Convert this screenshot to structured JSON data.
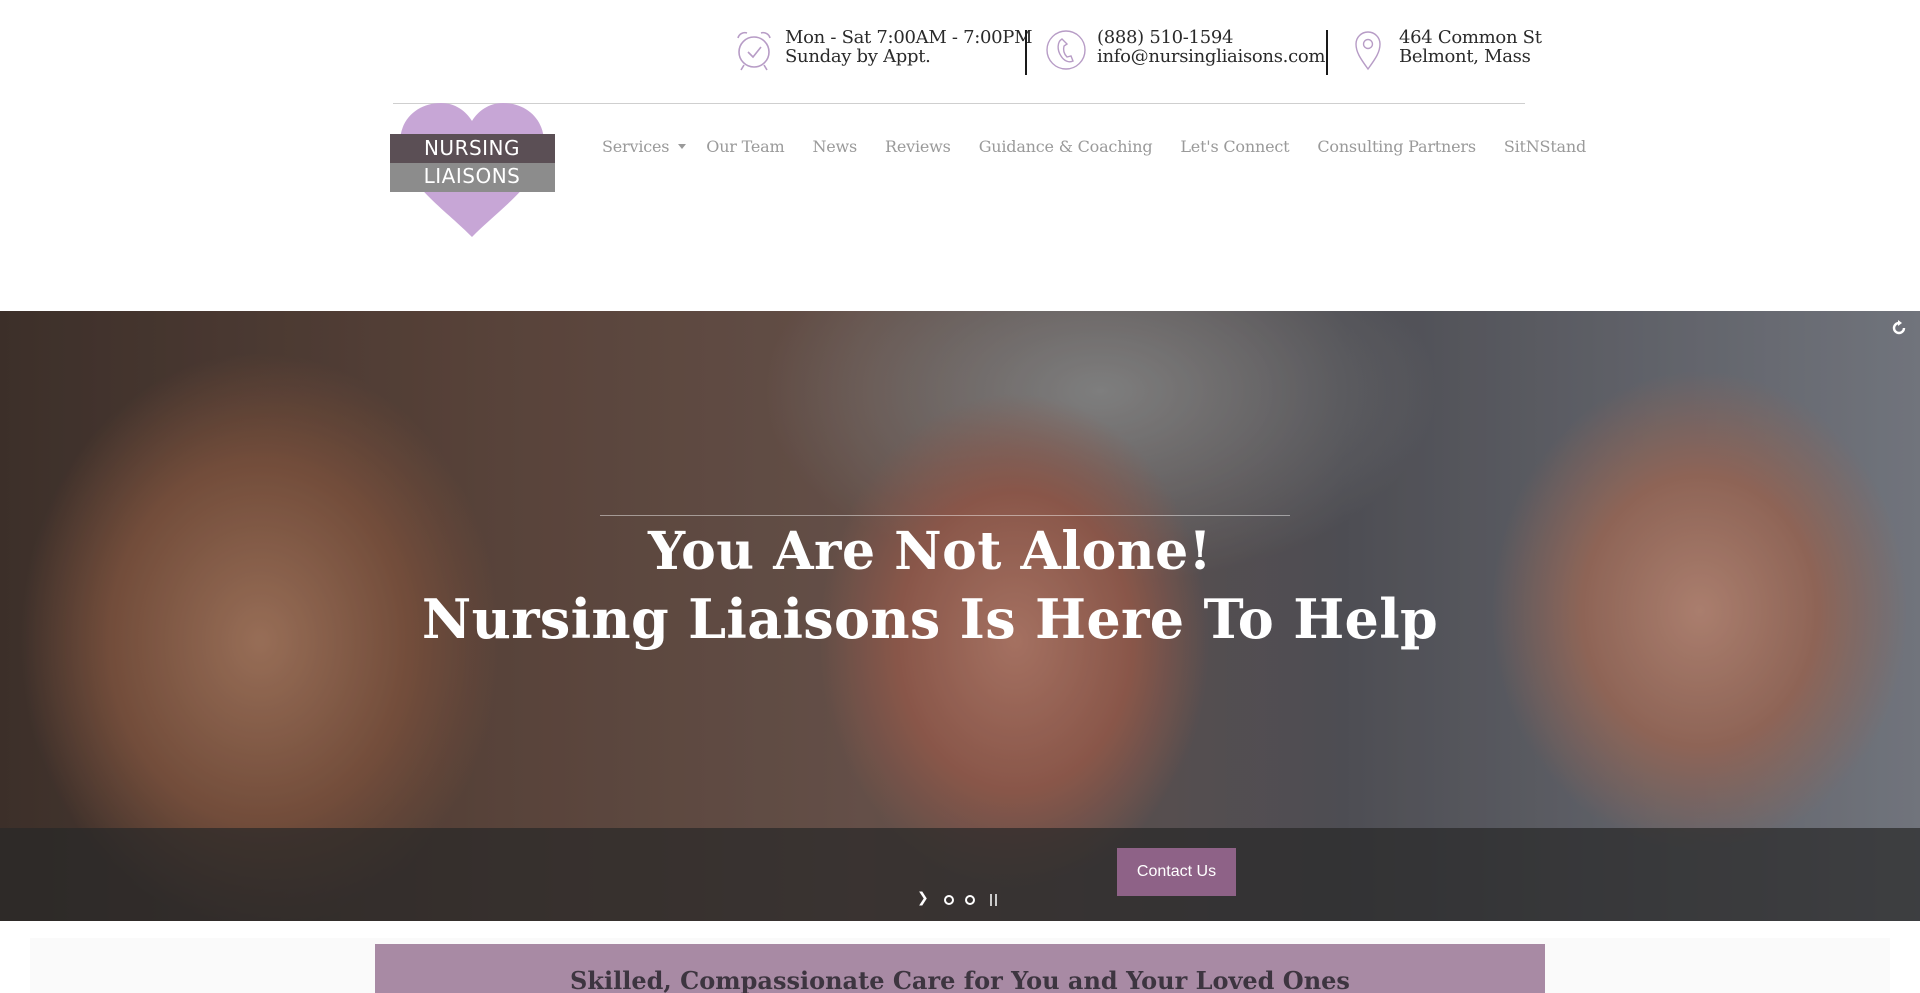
{
  "contact_bar": {
    "hours": {
      "icon": "alarm-clock-icon",
      "line1": "Mon - Sat 7:00AM - 7:00PM",
      "line2": "Sunday by Appt."
    },
    "phone": {
      "icon": "phone-icon",
      "line1": "(888) 510-1594",
      "line2": "info@nursingliaisons.com"
    },
    "address": {
      "icon": "map-pin-icon",
      "line1": "464 Common St",
      "line2": "Belmont, Mass"
    }
  },
  "logo": {
    "line1": "NURSING",
    "line2": "LIAISONS",
    "heart_color": "#c7a6d6"
  },
  "nav": {
    "items": [
      {
        "label": "Services",
        "has_dropdown": true
      },
      {
        "label": "Our Team"
      },
      {
        "label": "News"
      },
      {
        "label": "Reviews"
      },
      {
        "label": "Guidance & Coaching"
      },
      {
        "label": "Let's Connect"
      },
      {
        "label": "Consulting Partners"
      },
      {
        "label": "SitNStand"
      }
    ]
  },
  "hero": {
    "title_line1": "You Are Not Alone!",
    "title_line2": "Nursing Liaisons Is Here To Help",
    "cta_label": "Contact Us",
    "cta_color": "#8e6287",
    "slider": {
      "slide_count": 2
    }
  },
  "banner": {
    "title": "Skilled, Compassionate Care for You and Your Loved Ones",
    "color": "#a88aa4"
  }
}
